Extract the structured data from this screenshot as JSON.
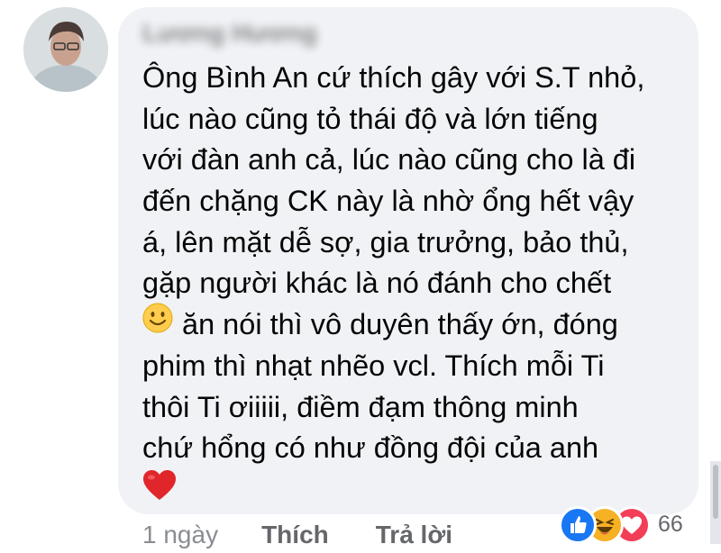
{
  "comment": {
    "author_blurred": "Lương Hương",
    "lines": [
      "Ông Bình An cứ thích gây với S.T nhỏ,",
      "lúc nào cũng tỏ thái độ và lớn tiếng",
      "với đàn anh cả, lúc nào cũng cho là đi",
      "đến chặng CK này là nhờ ổng hết vậy",
      "á, lên mặt dễ sợ, gia trưởng, bảo thủ,",
      "gặp người khác là nó đánh cho chết",
      "ăn nói thì vô duyên thấy ớn, đóng",
      "phim thì nhạt nhẽo vcl. Thích mỗi Ti",
      "thôi Ti ơiiiii, điềm đạm thông minh",
      "chứ hổng có như đồng đội của anh"
    ],
    "inline_emoji": "slightly-smiling-face-icon",
    "trailing_emoji": "red-heart-icon"
  },
  "actions": {
    "time": "1 ngày",
    "like": "Thích",
    "reply": "Trả lời"
  },
  "reactions": {
    "icons": [
      "like-icon",
      "haha-icon",
      "love-icon"
    ],
    "count": "66"
  },
  "colors": {
    "bubble": "#f0f2f5",
    "text": "#050505",
    "muted": "#65676b",
    "like_blue": "#1877f2",
    "love_red": "#f33e58",
    "haha_yellow": "#f7b125"
  }
}
